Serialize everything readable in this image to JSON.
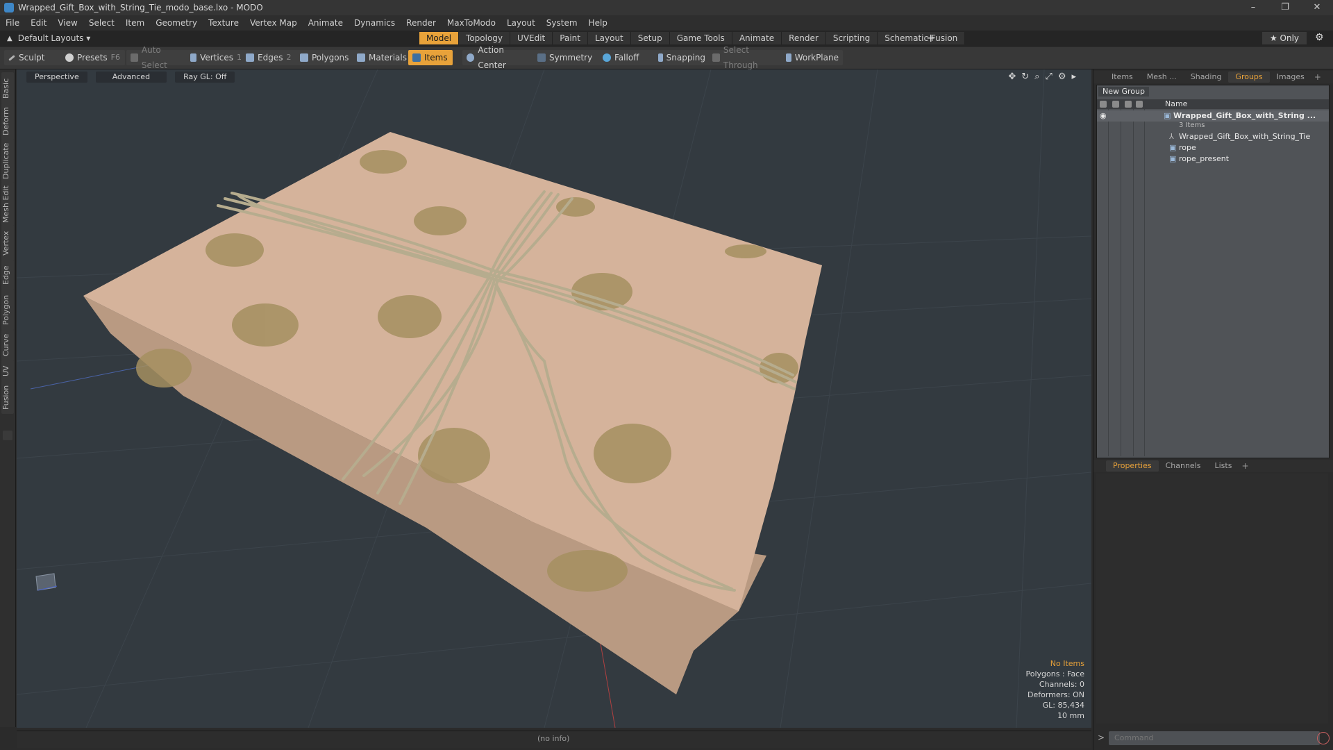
{
  "window": {
    "title": "Wrapped_Gift_Box_with_String_Tie_modo_base.lxo - MODO",
    "controls": [
      "–",
      "❐",
      "✕"
    ]
  },
  "menu": [
    "File",
    "Edit",
    "View",
    "Select",
    "Item",
    "Geometry",
    "Texture",
    "Vertex Map",
    "Animate",
    "Dynamics",
    "Render",
    "MaxToModo",
    "Layout",
    "System",
    "Help"
  ],
  "layout": {
    "selector": "Default Layouts ▾",
    "tabs": [
      "Model",
      "Topology",
      "UVEdit",
      "Paint",
      "Layout",
      "Setup",
      "Game Tools",
      "Animate",
      "Render",
      "Scripting",
      "Schematic Fusion"
    ],
    "active_tab": "Model",
    "plus": "+",
    "only_label": "★  Only",
    "gear": "⚙"
  },
  "toolbar": {
    "sculpt": "Sculpt",
    "presets": "Presets",
    "presets_key": "F6",
    "auto_select": "Auto Select",
    "vertices": "Vertices",
    "vertices_key": "1",
    "edges": "Edges",
    "edges_key": "2",
    "polygons": "Polygons",
    "materials": "Materials",
    "items": "Items",
    "action_center": "Action Center",
    "symmetry": "Symmetry",
    "falloff": "Falloff",
    "snapping": "Snapping",
    "select_through": "Select Through",
    "workplane": "WorkPlane"
  },
  "left_tabs": [
    "Basic",
    "Deform",
    "Duplicate",
    "Mesh Edit",
    "Vertex",
    "Edge",
    "Polygon",
    "Curve",
    "UV",
    "Fusion"
  ],
  "viewport": {
    "view": "Perspective",
    "shading": "Advanced",
    "raygl": "Ray GL: Off",
    "hud": {
      "no_items": "No Items",
      "polygons": "Polygons : Face",
      "channels": "Channels: 0",
      "deformers": "Deformers: ON",
      "gl": "GL: 85,434",
      "scale": "10 mm"
    }
  },
  "right_panel": {
    "top_tabs": [
      "Items",
      "Mesh ...",
      "Shading",
      "Groups",
      "Images"
    ],
    "active_top_tab": "Groups",
    "new_group": "New Group",
    "name_header": "Name",
    "tree": {
      "root": "Wrapped_Gift_Box_with_String ...",
      "root_sub": "3 Items",
      "children": [
        "Wrapped_Gift_Box_with_String_Tie",
        "rope",
        "rope_present"
      ]
    },
    "bottom_tabs": [
      "Properties",
      "Channels",
      "Lists"
    ],
    "active_bottom_tab": "Properties",
    "command_placeholder": "Command"
  },
  "status": {
    "info": "(no info)"
  },
  "colors": {
    "accent": "#e8a23a",
    "viewport_bg": "#333a40",
    "panel_list": "#505357",
    "paper": "#d3b096",
    "dots": "#a38d5e",
    "rope": "#b7ad8f"
  }
}
